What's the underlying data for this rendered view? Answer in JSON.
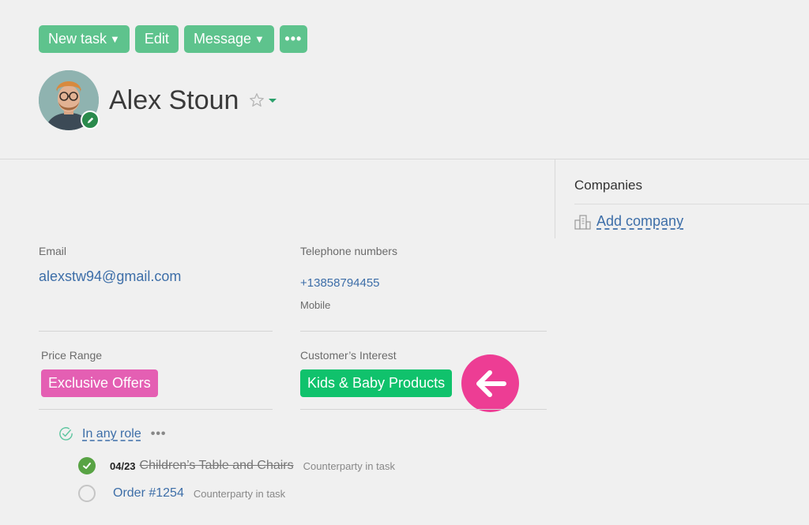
{
  "toolbar": {
    "new_task": "New task",
    "edit": "Edit",
    "message": "Message",
    "more": "•••"
  },
  "contact": {
    "name": "Alex Stoun"
  },
  "companies": {
    "title": "Companies",
    "add_label": "Add company"
  },
  "fields": {
    "email_label": "Email",
    "email_value": "alexstw94@gmail.com",
    "phone_label": "Telephone numbers",
    "phone_value": "+13858794455",
    "phone_type": "Mobile",
    "price_label": "Price Range",
    "price_value": "Exclusive Offers",
    "interest_label": "Customer’s Interest",
    "interest_value": "Kids & Baby Products"
  },
  "roles": {
    "label": "In any role",
    "more": "•••"
  },
  "tasks": [
    {
      "date": "04/23",
      "title": "Children’s Table and Chairs",
      "subtitle": "Counterparty in task",
      "done": true
    },
    {
      "date": "",
      "title": "Order #1254",
      "subtitle": "Counterparty in task",
      "done": false
    }
  ],
  "colors": {
    "accent_green": "#5ec38d",
    "tag_pink": "#e45fb3",
    "tag_green": "#10c26c",
    "arrow_pink": "#ed3d94",
    "link_blue": "#3d6ea8"
  }
}
